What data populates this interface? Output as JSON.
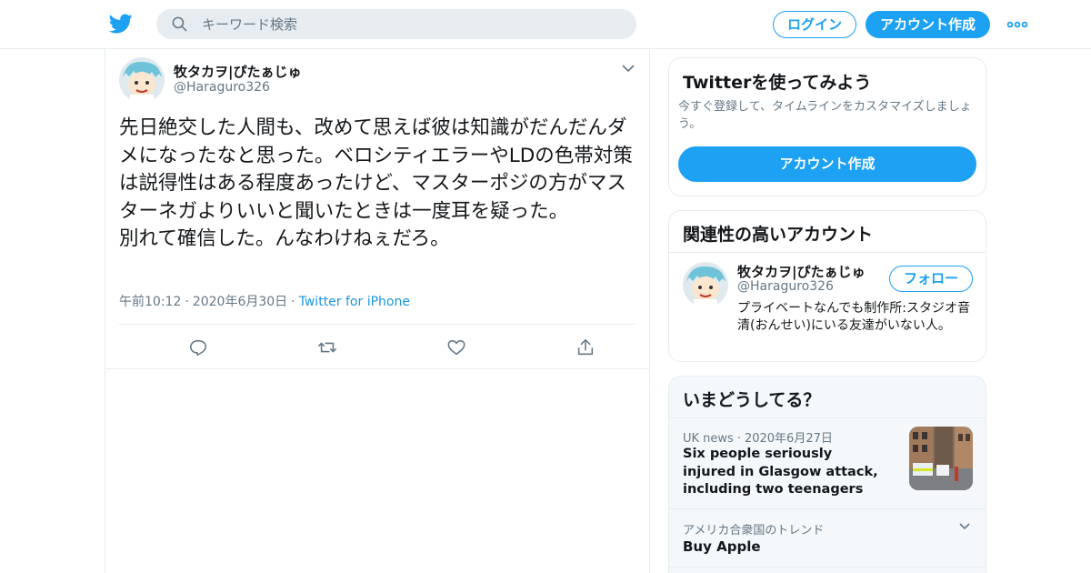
{
  "header": {
    "search_placeholder": "キーワード検索",
    "login_label": "ログイン",
    "signup_label": "アカウント作成",
    "icons": [
      "twitter-bird-icon",
      "search-icon",
      "more-dots-icon"
    ],
    "brand_color": "#1da1f2"
  },
  "tweet": {
    "display_name": "牧タカヲ|ぴたぁじゅ",
    "handle": "@Haraguro326",
    "text": "先日絶交した人間も、改めて思えば彼は知識がだんだんダメになったなと思った。ベロシティエラーやLDの色帯対策は説得性はある程度あったけど、マスターポジの方がマスターネガよりいいと聞いたときは一度耳を疑った。\n別れて確信した。んなわけねぇだろ。",
    "time": "午前10:12",
    "date": "2020年6月30日",
    "source": "Twitter for iPhone",
    "actions": [
      "reply-icon",
      "retweet-icon",
      "like-icon",
      "share-icon"
    ]
  },
  "sidebar": {
    "signup_card": {
      "title": "Twitterを使ってみよう",
      "description": "今すぐ登録して、タイムラインをカスタマイズしましょう。",
      "button_label": "アカウント作成"
    },
    "related": {
      "title": "関連性の高いアカウント",
      "name": "牧タカヲ|ぴたぁじゅ",
      "handle": "@Haraguro326",
      "follow_label": "フォロー",
      "bio": "プライベートなんでも制作所:スタジオ音清(おんせい)にいる友達がいない人。"
    },
    "trends": {
      "title": "いまどうしてる？",
      "news": {
        "category": "UK news",
        "date": "2020年6月27日",
        "headline": "Six people seriously injured in Glasgow attack, including two teenagers"
      },
      "trend": {
        "context": "アメリカ合衆国のトレンド",
        "name": "Buy Apple"
      }
    }
  }
}
